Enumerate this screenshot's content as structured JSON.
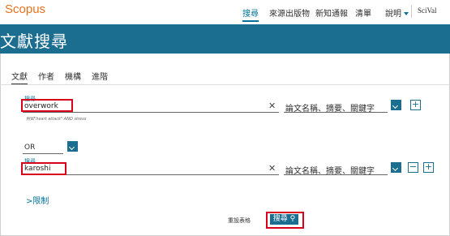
{
  "app": {
    "logo": "Scopus"
  },
  "topnav": {
    "items": [
      "搜尋",
      "來源出版物",
      "新知通報",
      "清單",
      "說明"
    ],
    "brand": "SciVal"
  },
  "banner": {
    "title": "文獻搜尋"
  },
  "tabs": [
    "文獻",
    "作者",
    "機構",
    "進階"
  ],
  "search": {
    "row1": {
      "label": "搜尋",
      "value": "overwork",
      "scope": "論文名稱、摘要、關鍵字",
      "hint": "例如\"heart attack\" AND stress"
    },
    "operator": "OR",
    "row2": {
      "label": "搜尋",
      "value": "karoshi",
      "scope": "論文名稱、摘要、關鍵字"
    },
    "limit_label": "限制",
    "reset_label": "重設表格",
    "search_label": "搜尋"
  },
  "colors": {
    "accent": "#1c6e91",
    "brand": "#e9711c",
    "highlight": "#d9001b"
  }
}
